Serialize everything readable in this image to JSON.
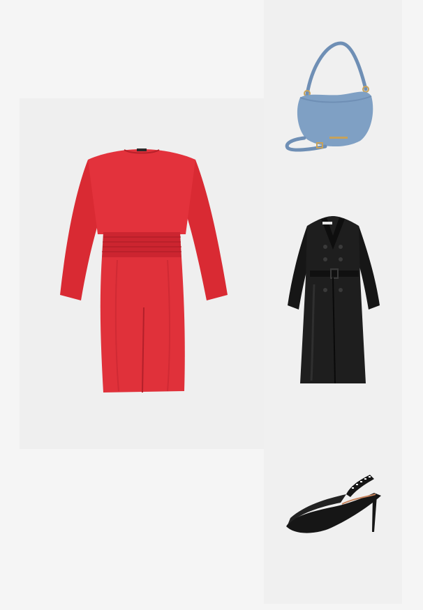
{
  "outfit": {
    "items": [
      {
        "id": "dress",
        "name": "Red long-sleeve dress",
        "icon": "red-dress-image",
        "color": "#e0313a"
      },
      {
        "id": "bag",
        "name": "Light blue shoulder bag",
        "icon": "blue-handbag-image",
        "color": "#7fa0c4"
      },
      {
        "id": "coat",
        "name": "Black trench coat",
        "icon": "black-trench-coat-image",
        "color": "#1b1b1b"
      },
      {
        "id": "shoe",
        "name": "Black slingback pump",
        "icon": "black-slingback-heel-image",
        "color": "#161616"
      }
    ]
  },
  "colors": {
    "page_background": "#f5f5f5",
    "tile_background": "#efefef"
  }
}
